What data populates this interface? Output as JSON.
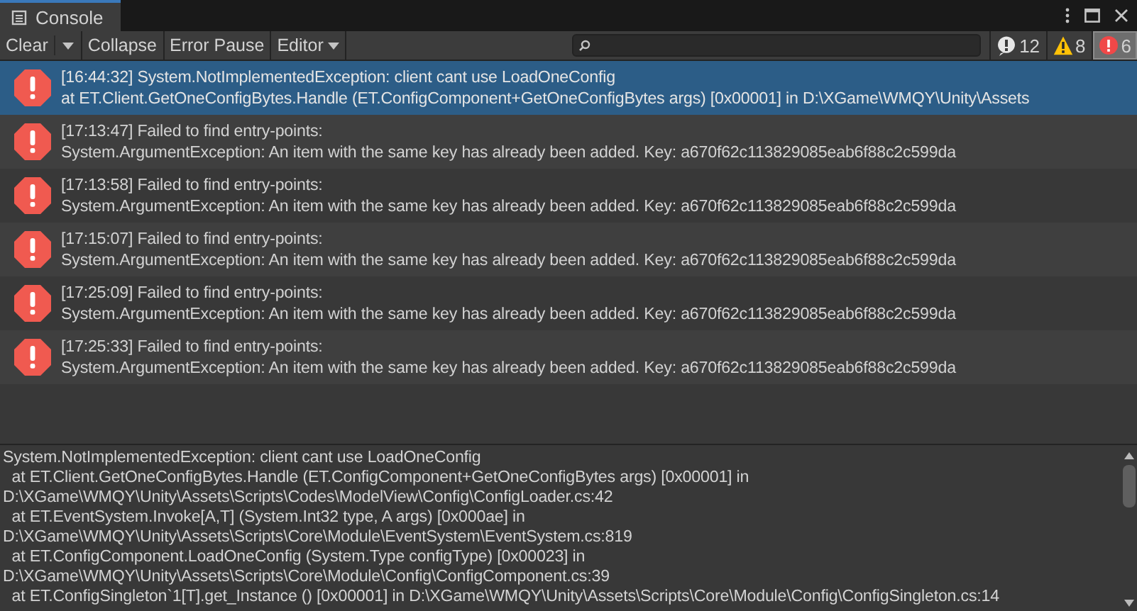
{
  "window": {
    "tab": "Console"
  },
  "toolbar": {
    "buttons": [
      {
        "label": "Clear",
        "kind": "split"
      },
      {
        "label": "Collapse",
        "kind": "toggle",
        "selected": false
      },
      {
        "label": "Error Pause",
        "kind": "toggle",
        "selected": false
      },
      {
        "label": "Editor",
        "kind": "dropdown"
      }
    ],
    "filters": [
      {
        "kind": "log",
        "count": "12",
        "selected": false
      },
      {
        "kind": "warning",
        "count": "8",
        "selected": false
      },
      {
        "kind": "error",
        "count": "6",
        "selected": true
      }
    ]
  },
  "entries": [
    {
      "kind": "error",
      "selected": true,
      "lines": [
        "[16:44:32] System.NotImplementedException: client cant use LoadOneConfig",
        "  at ET.Client.GetOneConfigBytes.Handle (ET.ConfigComponent+GetOneConfigBytes args) [0x00001] in D:\\XGame\\WMQY\\Unity\\Assets"
      ]
    },
    {
      "kind": "error",
      "selected": false,
      "lines": [
        "[17:13:47] Failed to find entry-points:",
        "System.ArgumentException: An item with the same key has already been added. Key: a670f62c113829085eab6f88c2c599da"
      ]
    },
    {
      "kind": "error",
      "selected": false,
      "lines": [
        "[17:13:58] Failed to find entry-points:",
        "System.ArgumentException: An item with the same key has already been added. Key: a670f62c113829085eab6f88c2c599da"
      ]
    },
    {
      "kind": "error",
      "selected": false,
      "lines": [
        "[17:15:07] Failed to find entry-points:",
        "System.ArgumentException: An item with the same key has already been added. Key: a670f62c113829085eab6f88c2c599da"
      ]
    },
    {
      "kind": "error",
      "selected": false,
      "lines": [
        "[17:25:09] Failed to find entry-points:",
        "System.ArgumentException: An item with the same key has already been added. Key: a670f62c113829085eab6f88c2c599da"
      ]
    },
    {
      "kind": "error",
      "selected": false,
      "lines": [
        "[17:25:33] Failed to find entry-points:",
        "System.ArgumentException: An item with the same key has already been added. Key: a670f62c113829085eab6f88c2c599da"
      ]
    }
  ],
  "details": [
    "System.NotImplementedException: client cant use LoadOneConfig",
    "  at ET.Client.GetOneConfigBytes.Handle (ET.ConfigComponent+GetOneConfigBytes args) [0x00001] in",
    "D:\\XGame\\WMQY\\Unity\\Assets\\Scripts\\Codes\\ModelView\\Config\\ConfigLoader.cs:42",
    "  at ET.EventSystem.Invoke[A,T] (System.Int32 type, A args) [0x000ae] in",
    "D:\\XGame\\WMQY\\Unity\\Assets\\Scripts\\Core\\Module\\EventSystem\\EventSystem.cs:819",
    "  at ET.ConfigComponent.LoadOneConfig (System.Type configType) [0x00023] in",
    "D:\\XGame\\WMQY\\Unity\\Assets\\Scripts\\Core\\Module\\Config\\ConfigComponent.cs:39",
    "  at ET.ConfigSingleton`1[T].get_Instance () [0x00001] in D:\\XGame\\WMQY\\Unity\\Assets\\Scripts\\Core\\Module\\Config\\ConfigSingleton.cs:14"
  ]
}
